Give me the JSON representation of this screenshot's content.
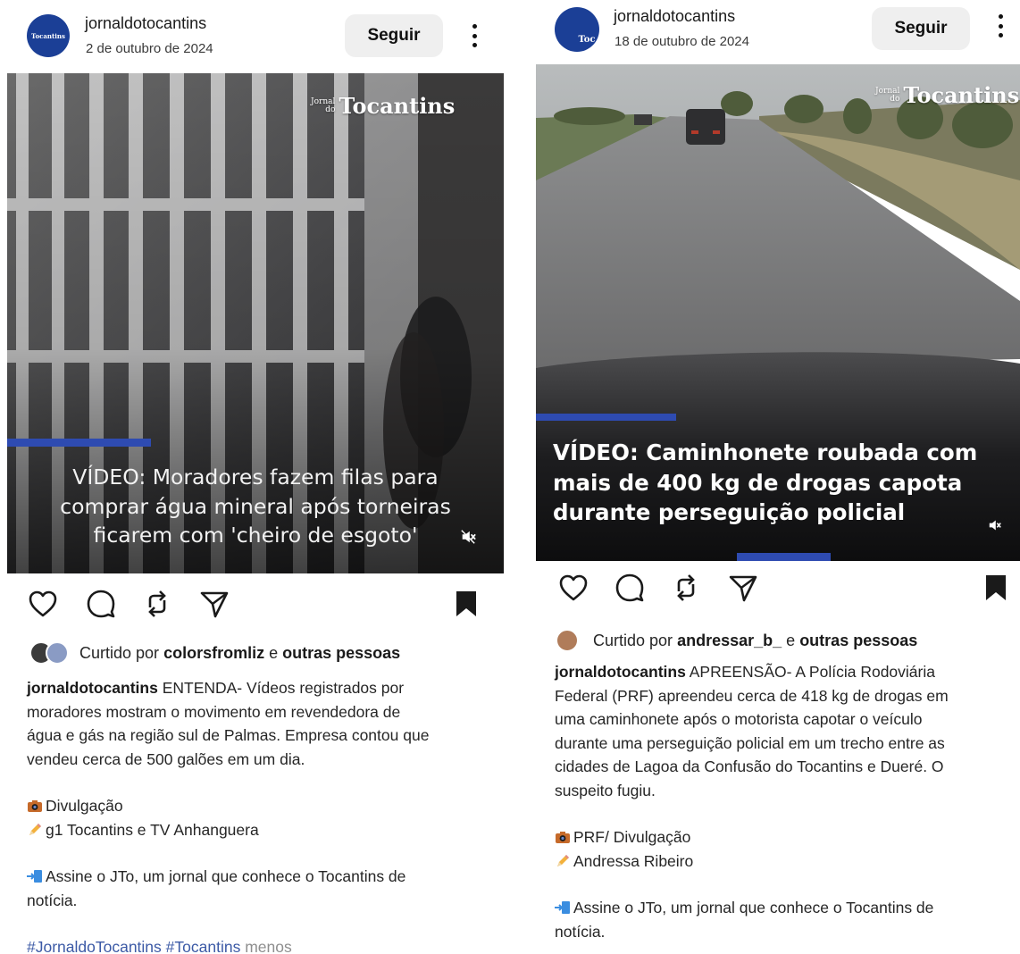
{
  "posts": [
    {
      "username": "jornaldotocantins",
      "date": "2 de outubro de 2024",
      "avatar_text": "Tocantins",
      "follow_label": "Seguir",
      "brand": {
        "small_1": "Jornal",
        "small_2": "do",
        "big": "Tocantins"
      },
      "video_progress": 0.29,
      "overlay_lines": [
        "VÍDEO: Moradores fazem filas para",
        "comprar água mineral após torneiras",
        "ficarem com 'cheiro de esgoto'"
      ],
      "likes": {
        "prefix": "Curtido por",
        "user": "colorsfromliz",
        "middle": "e",
        "others": "outras pessoas"
      },
      "caption": {
        "username": "jornaldotocantins",
        "lines": [
          "ENTENDA- Vídeos registrados por",
          "moradores mostram o movimento em revendedora de",
          "água e gás na região sul de Palmas. Empresa contou que",
          "vendeu cerca de 500 galões em um dia."
        ],
        "photo_credit": "Divulgação",
        "text_credit": "g1 Tocantins e TV Anhanguera",
        "cta_lines": [
          "Assine o JTo, um jornal que conhece o Tocantins de",
          "notícia."
        ],
        "hashtags": "#JornaldoTocantins #Tocantins",
        "less": "menos"
      }
    },
    {
      "username": "jornaldotocantins",
      "date": "18 de outubro de 2024",
      "avatar_text": "Toc",
      "follow_label": "Seguir",
      "brand": {
        "small_1": "Jornal",
        "small_2": "do",
        "big": "Tocantins"
      },
      "video_progress": 0.29,
      "overlay_lines": [
        "VÍDEO: Caminhonete roubada com",
        "mais de 400 kg de drogas capota",
        "durante perseguição policial"
      ],
      "likes": {
        "prefix": "Curtido por",
        "user": "andressar_b_",
        "middle": "e",
        "others": "outras pessoas"
      },
      "caption": {
        "username": "jornaldotocantins",
        "lines": [
          "APREENSÃO- A Polícia Rodoviária",
          "Federal (PRF) apreendeu cerca de 418 kg de drogas em",
          "uma caminhonete após o motorista capotar o veículo",
          "durante uma perseguição policial em um trecho entre as",
          "cidades de Lagoa da Confusão do Tocantins e Dueré. O",
          "suspeito fugiu."
        ],
        "photo_credit": "PRF/ Divulgação",
        "text_credit": "Andressa Ribeiro",
        "cta_lines": [
          "Assine o JTo, um jornal que conhece o Tocantins de",
          "notícia."
        ]
      }
    }
  ],
  "icons": [
    "heart-icon",
    "comment-icon",
    "repost-icon",
    "share-icon",
    "bookmark-icon",
    "mute-icon",
    "more-icon",
    "camera-emoji",
    "pencil-emoji",
    "arrow-emoji"
  ]
}
